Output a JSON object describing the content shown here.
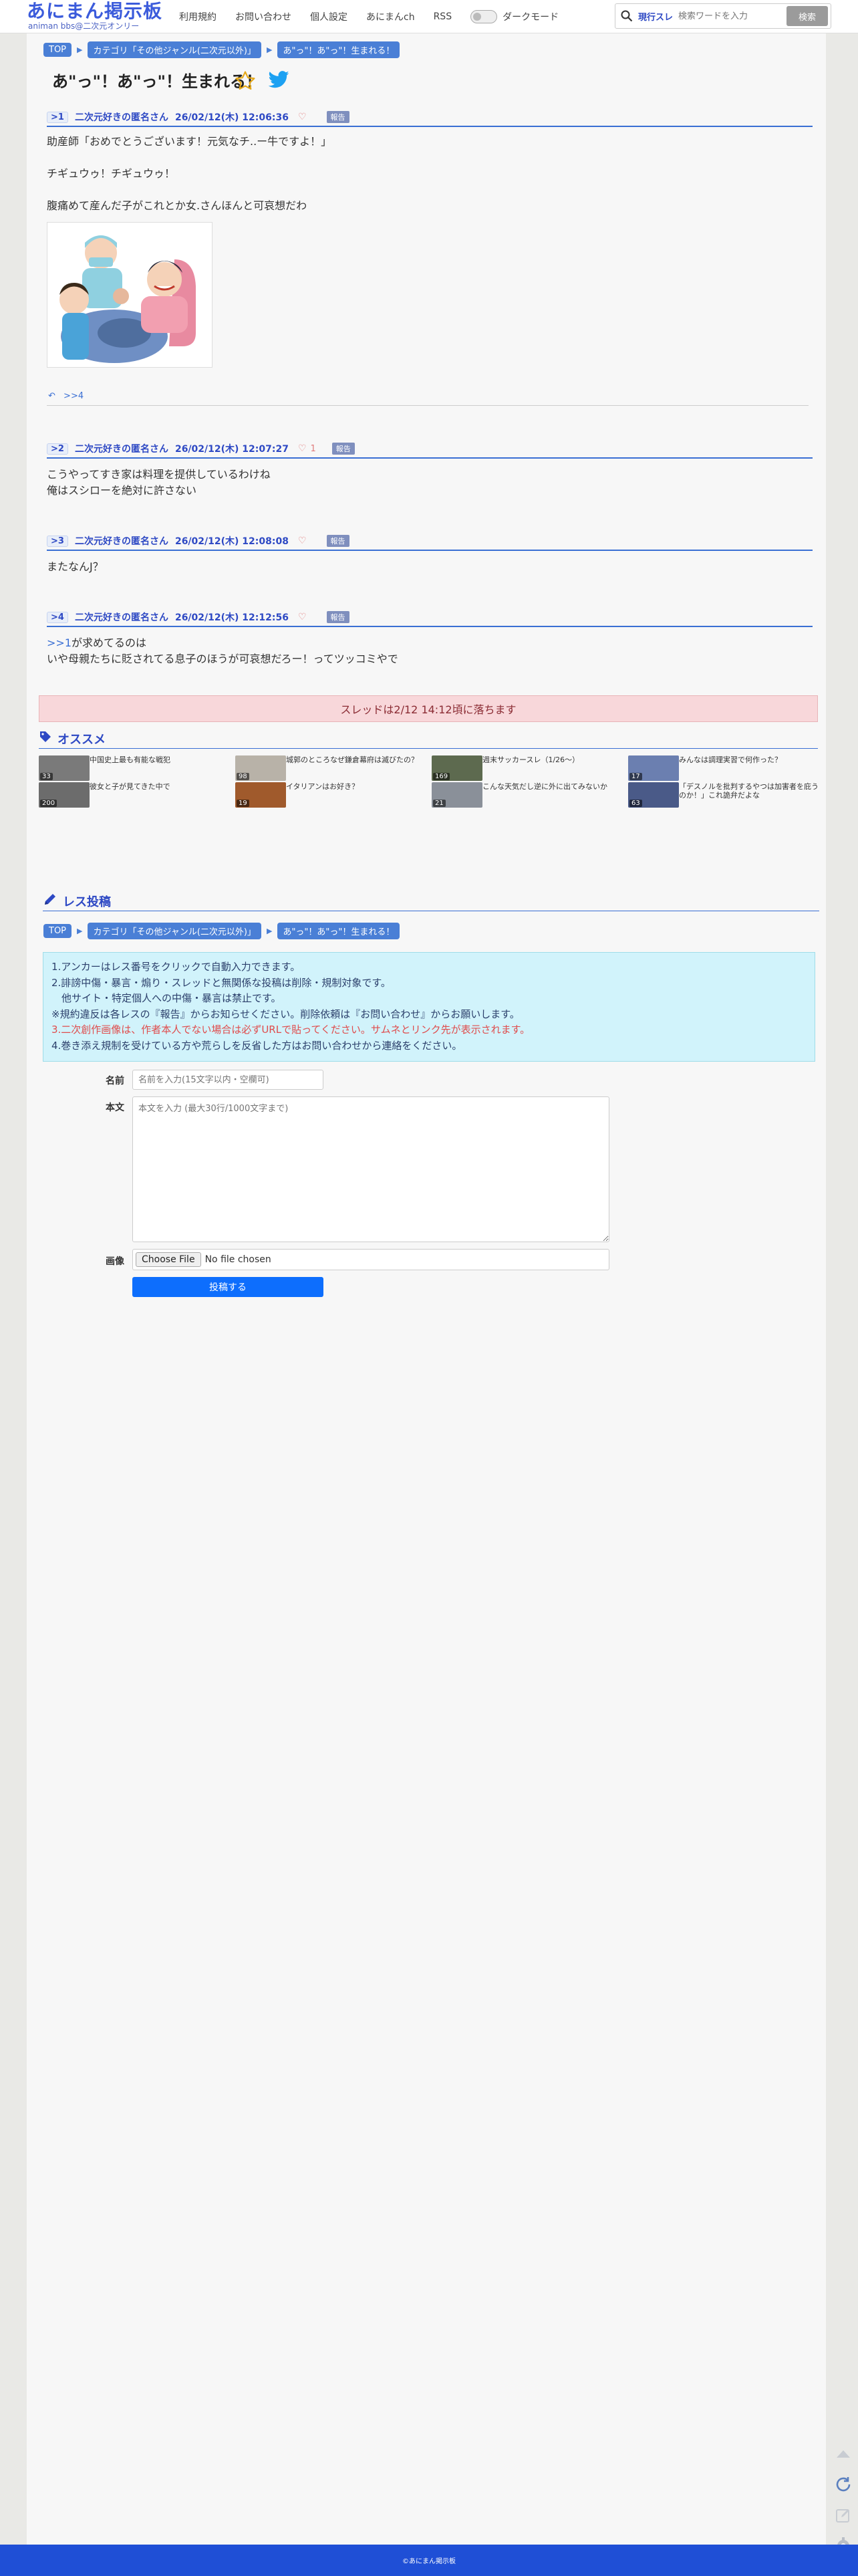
{
  "header": {
    "logo_main": "あにまん掲示板",
    "logo_sub": "animan bbs@二次元オンリー",
    "nav": [
      "利用規約",
      "お問い合わせ",
      "個人設定",
      "あにまんch",
      "RSS"
    ],
    "dark_mode_label": "ダークモード",
    "search_mode": "現行スレ",
    "search_placeholder": "検索ワードを入力",
    "search_button": "検索"
  },
  "breadcrumbs": [
    "TOP",
    "カテゴリ「その他ジャンル(二次元以外)」",
    "あ\"っ\"！あ\"っ\"！生まれる！"
  ],
  "thread": {
    "title": "あ\"っ\"！あ\"っ\"！生まれる！"
  },
  "posts": [
    {
      "no": ">1",
      "name": "二次元好きの匿名さん",
      "date": "26/02/12(木) 12:06:36",
      "likes": "",
      "report": "報告",
      "lines": [
        "助産師「おめでとうございます！元気なチ..ー牛ですよ！」",
        "",
        "チギュウゥ！チギュウゥ！",
        "",
        "腹痛めて産んだ子がこれとか女.さんほんと可哀想だわ"
      ],
      "reply": ">>4"
    },
    {
      "no": ">2",
      "name": "二次元好きの匿名さん",
      "date": "26/02/12(木) 12:07:27",
      "likes": "1",
      "report": "報告",
      "lines": [
        "こうやってすき家は料理を提供しているわけね",
        "俺はスシローを絶対に許さない"
      ]
    },
    {
      "no": ">3",
      "name": "二次元好きの匿名さん",
      "date": "26/02/12(木) 12:08:08",
      "likes": "",
      "report": "報告",
      "lines": [
        "またなんJ？"
      ]
    },
    {
      "no": ">4",
      "name": "二次元好きの匿名さん",
      "date": "26/02/12(木) 12:12:56",
      "likes": "",
      "report": "報告",
      "anchor": ">>1",
      "lines": [
        "が求めてるのは",
        "いや母親たちに貶されてる息子のほうが可哀想だろー！ってツッコミやで"
      ]
    }
  ],
  "thread_drop": "スレッドは2/12 14:12頃に落ちます",
  "recommend": {
    "title": "オススメ",
    "items": [
      {
        "title": "中国史上最も有能な戦犯",
        "count": "33",
        "color": "#7a7a7a"
      },
      {
        "title": "城郭のところなぜ鎌倉幕府は滅びたの？",
        "count": "98",
        "color": "#b8b2a8"
      },
      {
        "title": "週末サッカースレ（1/26〜）",
        "count": "169",
        "color": "#5d6a4f"
      },
      {
        "title": "みんなは調理実習で何作った？",
        "count": "17",
        "color": "#6b7fb0"
      },
      {
        "title": "彼女と子が見てきた中で",
        "count": "200",
        "color": "#6c6c6c"
      },
      {
        "title": "イタリアンはお好き？",
        "count": "19",
        "color": "#a05a2c"
      },
      {
        "title": "こんな天気だし逆に外に出てみないか",
        "count": "21",
        "color": "#8a9099"
      },
      {
        "title": "「デスノルを批判するやつは加害者を庇うのか！」これ詭弁だよな",
        "count": "63",
        "color": "#4a5a88"
      }
    ]
  },
  "form": {
    "title": "レス投稿",
    "notice": [
      {
        "text": "1.アンカーはレス番号をクリックで自動入力できます。",
        "style": ""
      },
      {
        "text": "2.誹謗中傷・暴言・煽り・スレッドと無関係な投稿は削除・規制対象です。",
        "style": ""
      },
      {
        "text": "　他サイト・特定個人への中傷・暴言は禁止です。",
        "style": ""
      },
      {
        "text": "※規約違反は各レスの『報告』からお知らせください。削除依頼は『お問い合わせ』からお願いします。",
        "style": ""
      },
      {
        "text": "3.二次創作画像は、作者本人でない場合は必ずURLで貼ってください。サムネとリンク先が表示されます。",
        "style": "red"
      },
      {
        "text": "4.巻き添え規制を受けている方や荒らしを反省した方はお問い合わせから連絡をください。",
        "style": ""
      }
    ],
    "name_label": "名前",
    "name_placeholder": "名前を入力(15文字以内・空欄可)",
    "body_label": "本文",
    "body_placeholder": "本文を入力 (最大30行/1000文字まで)",
    "image_label": "画像",
    "file_button": "Choose File",
    "file_status": "No file chosen",
    "submit": "投稿する"
  },
  "footer": "©あにまん掲示板",
  "colors": {
    "accent": "#3a6fd4",
    "brand": "#3b5bdb",
    "footer": "#1f4fd6",
    "alert_bg": "#f8d7da",
    "notice_bg": "#d1f3fb"
  }
}
